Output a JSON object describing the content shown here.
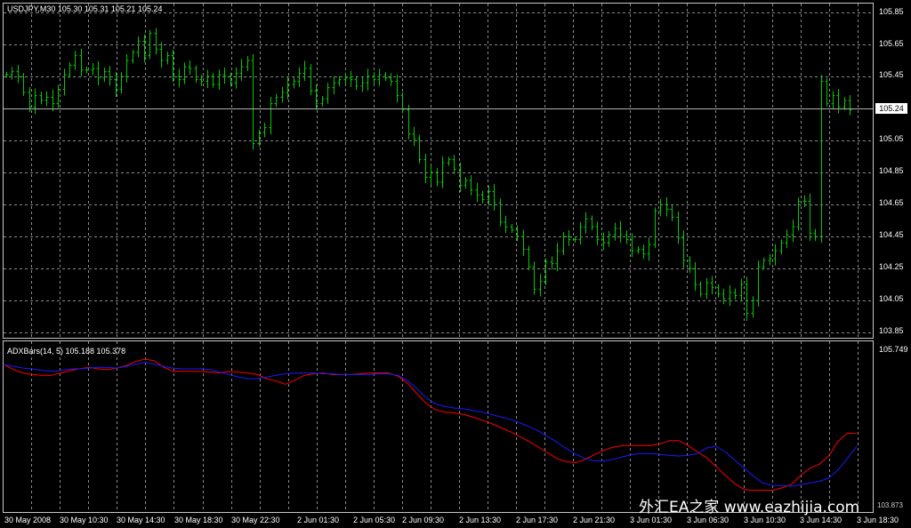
{
  "main_pane": {
    "title": "USDJPY,M30  105.30 105.31 105.21 105.24",
    "current_price": "105.24",
    "price_axis": [
      "105.85",
      "105.65",
      "105.45",
      "105.24",
      "105.05",
      "104.85",
      "104.65",
      "104.45",
      "104.25",
      "104.05",
      "103.85"
    ]
  },
  "indicator_pane": {
    "title": "ADXBars(14, 5) 105.188 105.378",
    "top_value": "105.749",
    "bottom_value": "103.873"
  },
  "time_axis": [
    "30 May 2008",
    "30 May 10:30",
    "30 May 14:30",
    "30 May 18:30",
    "30 May 22:30",
    "2 Jun 01:30",
    "2 Jun 05:30",
    "2 Jun 09:30",
    "2 Jun 13:30",
    "2 Jun 17:30",
    "2 Jun 21:30",
    "3 Jun 01:30",
    "3 Jun 06:30",
    "3 Jun 10:30",
    "3 Jun 14:30",
    "3 Jun 18:30"
  ],
  "watermark": "外汇EA之家 www.eazhijia.com",
  "colors": {
    "background": "#000000",
    "bars": "#00cc00",
    "grid": "#8a8a8a",
    "line_red": "#ff0000",
    "line_blue": "#1a1aff"
  },
  "chart_data": [
    {
      "type": "line",
      "subtype": "ohlc-bars",
      "symbol": "USDJPY",
      "timeframe": "M30",
      "ylim": [
        103.85,
        105.85
      ],
      "close": [
        105.46,
        105.48,
        105.45,
        105.35,
        105.26,
        105.33,
        105.3,
        105.32,
        105.28,
        105.37,
        105.46,
        105.52,
        105.58,
        105.49,
        105.49,
        105.5,
        105.44,
        105.48,
        105.43,
        105.37,
        105.45,
        105.55,
        105.6,
        105.67,
        105.58,
        105.72,
        105.62,
        105.55,
        105.58,
        105.45,
        105.43,
        105.51,
        105.5,
        105.43,
        105.42,
        105.45,
        105.4,
        105.46,
        105.45,
        105.41,
        105.47,
        105.51,
        105.55,
        105.03,
        105.1,
        105.13,
        105.28,
        105.32,
        105.35,
        105.4,
        105.42,
        105.47,
        105.5,
        105.36,
        105.28,
        105.31,
        105.38,
        105.41,
        105.43,
        105.44,
        105.43,
        105.39,
        105.41,
        105.45,
        105.43,
        105.46,
        105.44,
        105.42,
        105.33,
        105.24,
        105.09,
        105.06,
        104.93,
        104.82,
        104.85,
        104.79,
        104.91,
        104.93,
        104.87,
        104.77,
        104.8,
        104.74,
        104.71,
        104.68,
        104.73,
        104.66,
        104.54,
        104.51,
        104.49,
        104.45,
        104.37,
        104.26,
        104.12,
        104.17,
        104.29,
        104.28,
        104.36,
        104.45,
        104.43,
        104.43,
        104.51,
        104.56,
        104.51,
        104.43,
        104.41,
        104.46,
        104.5,
        104.46,
        104.43,
        104.36,
        104.37,
        104.34,
        104.4,
        104.61,
        104.65,
        104.62,
        104.57,
        104.44,
        104.3,
        104.25,
        104.15,
        104.09,
        104.16,
        104.13,
        104.09,
        104.06,
        104.1,
        104.08,
        104.15,
        103.97,
        104.05,
        104.26,
        104.3,
        104.31,
        104.36,
        104.41,
        104.46,
        104.51,
        104.67,
        104.67,
        104.47,
        104.45,
        105.42,
        105.28,
        105.33,
        105.26,
        105.3,
        105.24
      ]
    },
    {
      "type": "line",
      "ylim": [
        103.873,
        105.749
      ],
      "series": [
        {
          "color": "red",
          "values": [
            105.57,
            105.51,
            105.47,
            105.45,
            105.44,
            105.44,
            105.47,
            105.5,
            105.52,
            105.54,
            105.52,
            105.51,
            105.53,
            105.56,
            105.61,
            105.64,
            105.62,
            105.54,
            105.49,
            105.49,
            105.49,
            105.49,
            105.48,
            105.47,
            105.49,
            105.48,
            105.47,
            105.45,
            105.4,
            105.37,
            105.33,
            105.38,
            105.44,
            105.46,
            105.47,
            105.45,
            105.45,
            105.45,
            105.46,
            105.47,
            105.47,
            105.47,
            105.43,
            105.35,
            105.22,
            105.1,
            105.02,
            104.99,
            104.98,
            104.96,
            104.93,
            104.89,
            104.85,
            104.8,
            104.75,
            104.69,
            104.63,
            104.56,
            104.49,
            104.42,
            104.38,
            104.37,
            104.41,
            104.47,
            104.52,
            104.56,
            104.58,
            104.58,
            104.58,
            104.58,
            104.6,
            104.64,
            104.64,
            104.58,
            104.5,
            104.43,
            104.32,
            104.21,
            104.11,
            104.04,
            104.03,
            104.03,
            104.03,
            104.06,
            104.1,
            104.21,
            104.3,
            104.35,
            104.45,
            104.63,
            104.73,
            104.73
          ]
        },
        {
          "color": "blue",
          "values": [
            105.57,
            105.55,
            105.53,
            105.52,
            105.5,
            105.49,
            105.5,
            105.52,
            105.52,
            105.53,
            105.54,
            105.54,
            105.53,
            105.55,
            105.58,
            105.6,
            105.58,
            105.55,
            105.53,
            105.52,
            105.52,
            105.52,
            105.51,
            105.48,
            105.45,
            105.42,
            105.4,
            105.4,
            105.42,
            105.44,
            105.46,
            105.47,
            105.47,
            105.47,
            105.46,
            105.46,
            105.45,
            105.45,
            105.45,
            105.45,
            105.46,
            105.46,
            105.44,
            105.38,
            105.28,
            105.17,
            105.09,
            105.06,
            105.04,
            105.03,
            105.01,
            104.99,
            104.96,
            104.93,
            104.9,
            104.86,
            104.81,
            104.76,
            104.69,
            104.62,
            104.54,
            104.47,
            104.42,
            104.39,
            104.39,
            104.41,
            104.44,
            104.47,
            104.48,
            104.48,
            104.47,
            104.46,
            104.45,
            104.46,
            104.48,
            104.55,
            104.57,
            104.5,
            104.4,
            104.3,
            104.2,
            104.12,
            104.09,
            104.09,
            104.08,
            104.1,
            104.12,
            104.14,
            104.18,
            104.28,
            104.42,
            104.57
          ]
        }
      ]
    }
  ]
}
